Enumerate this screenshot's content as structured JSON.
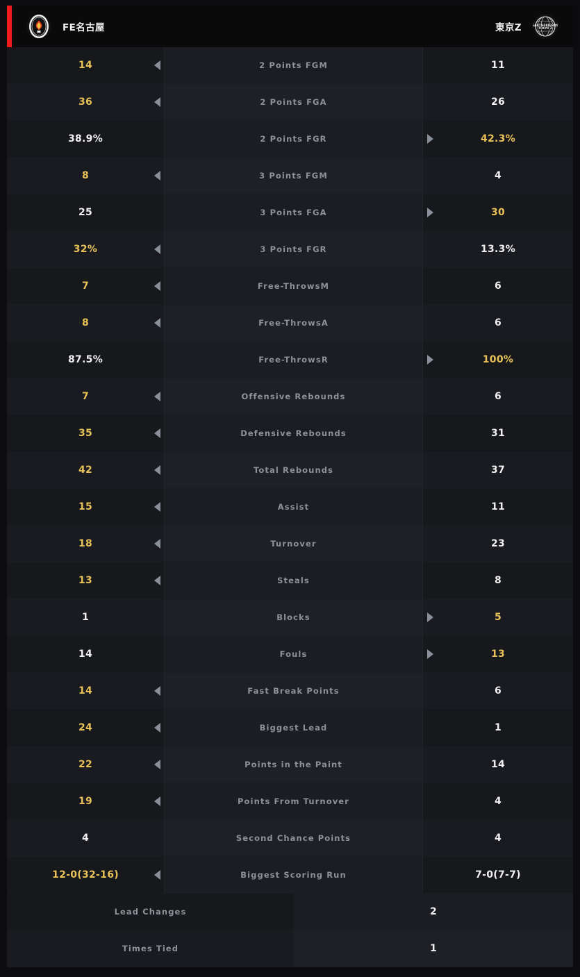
{
  "header": {
    "accent_color": "#ef1a1a",
    "home": {
      "name": "FE名古屋",
      "logo": "fighting-eagles-nagoya-logo"
    },
    "away": {
      "name": "東京Z",
      "logo": "earthfriends-tokyo-z-logo"
    }
  },
  "colors": {
    "winner": "#e8c158",
    "loser": "#f0f0f0",
    "label": "#8d9298",
    "arrow": "#8a9099"
  },
  "stats": [
    {
      "label": "2 Points FGM",
      "home": "14",
      "away": "11",
      "leader": "home"
    },
    {
      "label": "2 Points FGA",
      "home": "36",
      "away": "26",
      "leader": "home"
    },
    {
      "label": "2 Points FGR",
      "home": "38.9%",
      "away": "42.3%",
      "leader": "away"
    },
    {
      "label": "3 Points FGM",
      "home": "8",
      "away": "4",
      "leader": "home"
    },
    {
      "label": "3 Points FGA",
      "home": "25",
      "away": "30",
      "leader": "away"
    },
    {
      "label": "3 Points FGR",
      "home": "32%",
      "away": "13.3%",
      "leader": "home"
    },
    {
      "label": "Free-ThrowsM",
      "home": "7",
      "away": "6",
      "leader": "home"
    },
    {
      "label": "Free-ThrowsA",
      "home": "8",
      "away": "6",
      "leader": "home"
    },
    {
      "label": "Free-ThrowsR",
      "home": "87.5%",
      "away": "100%",
      "leader": "away"
    },
    {
      "label": "Offensive Rebounds",
      "home": "7",
      "away": "6",
      "leader": "home"
    },
    {
      "label": "Defensive Rebounds",
      "home": "35",
      "away": "31",
      "leader": "home"
    },
    {
      "label": "Total Rebounds",
      "home": "42",
      "away": "37",
      "leader": "home"
    },
    {
      "label": "Assist",
      "home": "15",
      "away": "11",
      "leader": "home"
    },
    {
      "label": "Turnover",
      "home": "18",
      "away": "23",
      "leader": "home"
    },
    {
      "label": "Steals",
      "home": "13",
      "away": "8",
      "leader": "home"
    },
    {
      "label": "Blocks",
      "home": "1",
      "away": "5",
      "leader": "away"
    },
    {
      "label": "Fouls",
      "home": "14",
      "away": "13",
      "leader": "away"
    },
    {
      "label": "Fast Break Points",
      "home": "14",
      "away": "6",
      "leader": "home"
    },
    {
      "label": "Biggest Lead",
      "home": "24",
      "away": "1",
      "leader": "home"
    },
    {
      "label": "Points in the Paint",
      "home": "22",
      "away": "14",
      "leader": "home"
    },
    {
      "label": "Points From Turnover",
      "home": "19",
      "away": "4",
      "leader": "home"
    },
    {
      "label": "Second Chance Points",
      "home": "4",
      "away": "4",
      "leader": "none"
    },
    {
      "label": "Biggest Scoring Run",
      "home": "12-0(32-16)",
      "away": "7-0(7-7)",
      "leader": "home"
    }
  ],
  "summary": [
    {
      "label": "Lead Changes",
      "value": "2"
    },
    {
      "label": "Times Tied",
      "value": "1"
    }
  ]
}
